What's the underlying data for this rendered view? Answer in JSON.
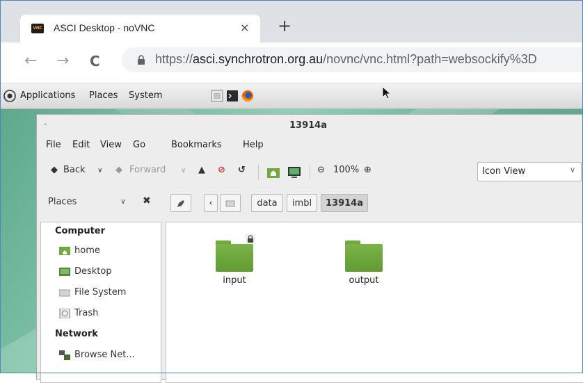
{
  "browser": {
    "tab_title": "ASCI Desktop - noVNC",
    "favicon_text": "VNC",
    "close_glyph": "×",
    "newtab_glyph": "+",
    "back_glyph": "←",
    "forward_glyph": "→",
    "reload_glyph": "C",
    "url_scheme": "https://",
    "url_host": "asci.synchrotron.org.au",
    "url_path": "/novnc/vnc.html?path=websockify%3D"
  },
  "panel": {
    "menus": [
      "Applications",
      "Places",
      "System"
    ]
  },
  "window": {
    "title_dash": "-",
    "title": "13914a",
    "menubar": [
      "File",
      "Edit",
      "View",
      "Go",
      "Bookmarks",
      "Help"
    ],
    "toolbar": {
      "back_label": "Back",
      "forward_label": "Forward",
      "zoom": "100%",
      "view_mode": "Icon View"
    },
    "location": {
      "places_label": "Places",
      "crumbs": [
        "data",
        "imbl",
        "13914a"
      ]
    },
    "sidebar": {
      "computer_header": "Computer",
      "computer_items": [
        "home",
        "Desktop",
        "File System",
        "Trash"
      ],
      "network_header": "Network",
      "network_items": [
        "Browse Net..."
      ]
    },
    "files": [
      "input",
      "output"
    ]
  },
  "colors": {
    "folder": "#72a840",
    "desktop": "#6ab99a",
    "accent": "#4a86c8"
  }
}
